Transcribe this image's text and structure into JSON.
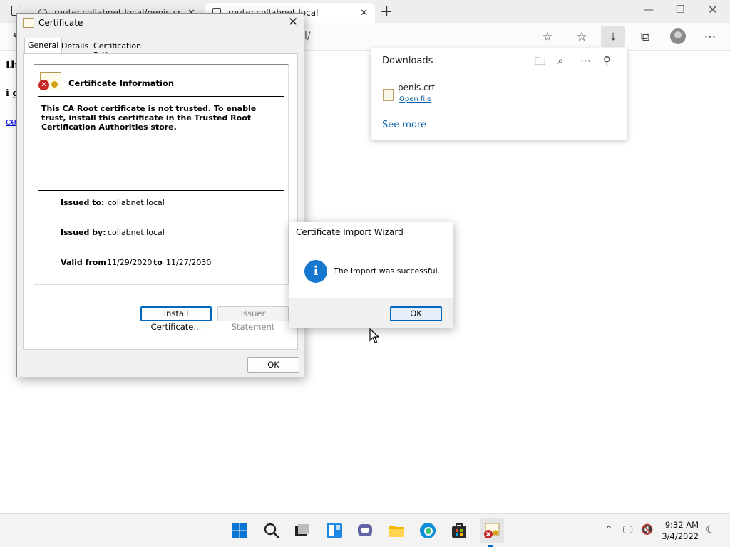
{
  "browser": {
    "tabs": [
      {
        "title": "router.collabnet.local/penis.crt",
        "active": false
      },
      {
        "title": "router.collabnet.local",
        "active": true
      }
    ],
    "address_tail": "l/",
    "page": {
      "line1": "th",
      "line2": "i g",
      "link": "ce"
    }
  },
  "downloads": {
    "title": "Downloads",
    "file_name": "penis.crt",
    "open_file": "Open file",
    "see_more": "See more"
  },
  "certificate": {
    "title": "Certificate",
    "tabs": [
      "General",
      "Details",
      "Certification Path"
    ],
    "info_title": "Certificate Information",
    "trust_message": "This CA Root certificate is not trusted. To enable trust, install this certificate in the Trusted Root Certification Authorities store.",
    "issued_to_label": "Issued to:",
    "issued_to": "collabnet.local",
    "issued_by_label": "Issued by:",
    "issued_by": "collabnet.local",
    "valid_from_label": "Valid from",
    "valid_from": "11/29/2020",
    "to_label": "to",
    "valid_to": "11/27/2030",
    "install_button": "Install Certificate...",
    "issuer_button": "Issuer Statement",
    "ok_button": "OK"
  },
  "wizard": {
    "title": "Certificate Import Wizard",
    "message": "The import was successful.",
    "ok_button": "OK"
  },
  "taskbar": {
    "time": "9:32 AM",
    "date": "3/4/2022"
  },
  "colors": {
    "accent": "#0067c0",
    "link": "#0a62b0",
    "info_icon": "#1577cd",
    "error": "#c62828"
  }
}
